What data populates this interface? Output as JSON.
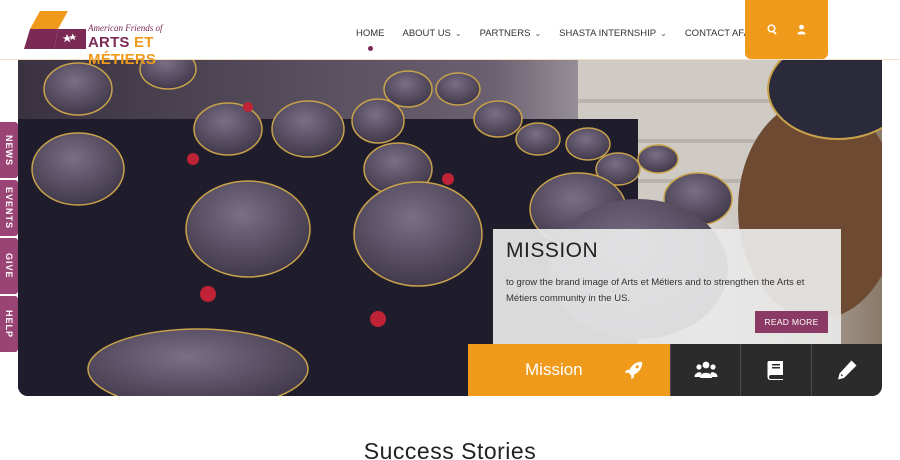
{
  "brand": {
    "logo_small": "American Friends of",
    "logo_big_part1": "ARTS ",
    "logo_big_part2": "ET MÉTIERS",
    "colors": {
      "purple": "#7b2a55",
      "orange": "#ef9a1a"
    }
  },
  "nav": {
    "items": [
      {
        "label": "HOME",
        "active": true,
        "has_dropdown": false
      },
      {
        "label": "ABOUT US",
        "active": false,
        "has_dropdown": true
      },
      {
        "label": "PARTNERS",
        "active": false,
        "has_dropdown": true
      },
      {
        "label": "SHASTA INTERNSHIP",
        "active": false,
        "has_dropdown": true
      },
      {
        "label": "CONTACT AFAM",
        "active": false,
        "has_dropdown": false
      }
    ],
    "tools": [
      {
        "icon": "search-icon"
      },
      {
        "icon": "user-icon"
      }
    ]
  },
  "side_tabs": [
    {
      "label": "NEWS"
    },
    {
      "label": "EVENTS"
    },
    {
      "label": "GIVE"
    },
    {
      "label": "HELP"
    }
  ],
  "hero": {
    "mission_title": "MISSION",
    "mission_text": "to grow the brand image of Arts et Métiers and to strengthen the Arts et Métiers community in the US.",
    "read_more": "READ MORE",
    "tabs": [
      {
        "label": "Mission",
        "icon": "rocket-icon",
        "active": true
      },
      {
        "label": "",
        "icon": "group-icon",
        "active": false
      },
      {
        "label": "",
        "icon": "book-icon",
        "active": false
      },
      {
        "label": "",
        "icon": "pencil-icon",
        "active": false
      }
    ]
  },
  "section": {
    "title": "Success Stories"
  }
}
